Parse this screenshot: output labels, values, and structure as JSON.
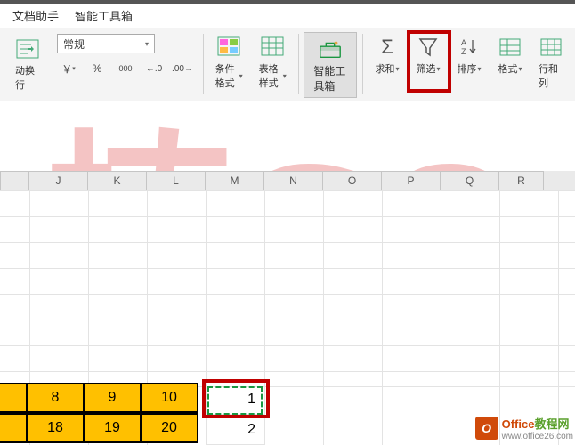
{
  "tabs": {
    "doc_helper": "文档助手",
    "smart_toolbox": "智能工具箱"
  },
  "ribbon": {
    "format_select_value": "常规",
    "currency_icon": "￥",
    "percent_icon": "%",
    "thousands_icon": "000",
    "dec_inc_icon": ".0",
    "dec_dec_icon": ".00",
    "auto_wrap": "动换行",
    "cond_format": "条件格式",
    "table_style": "表格样式",
    "smart_box": "智能工具箱",
    "sum": "求和",
    "filter": "筛选",
    "sort": "排序",
    "format": "格式",
    "rows_cols": "行和列"
  },
  "columns": [
    "J",
    "K",
    "L",
    "M",
    "N",
    "O",
    "P",
    "Q",
    "R"
  ],
  "data": {
    "row1": [
      "",
      "8",
      "9",
      "10"
    ],
    "row2": [
      "",
      "18",
      "19",
      "20"
    ],
    "extra": [
      "1",
      "2"
    ]
  },
  "logo": {
    "title_a": "Office",
    "title_b": "教程网",
    "url": "www.office26.com"
  },
  "watermark": "楠GO",
  "chart_data": {
    "type": "table",
    "columns": [
      "J",
      "K",
      "L",
      "M"
    ],
    "rows": [
      {
        "J": null,
        "K": 8,
        "L": 9,
        "M": 10,
        "extra": 1
      },
      {
        "J": null,
        "K": 18,
        "L": 19,
        "M": 20,
        "extra": 2
      }
    ]
  }
}
